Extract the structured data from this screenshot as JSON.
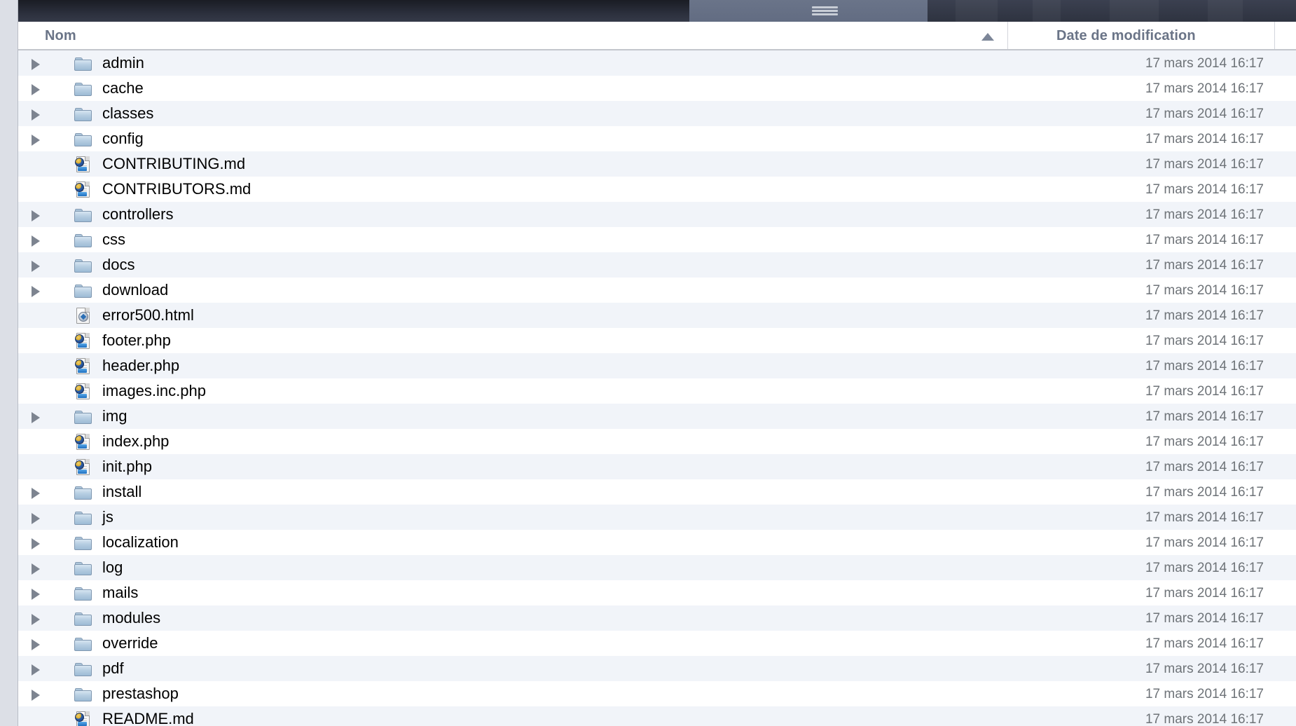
{
  "window": {
    "grip_icon": "drag-handle-icon"
  },
  "columns": {
    "name_label": "Nom",
    "date_label": "Date de modification",
    "sort_indicator": "sort-ascending-arrow",
    "sorted_by": "Nom",
    "sort_direction": "ascending"
  },
  "colors": {
    "row_stripe": "#f1f4f9",
    "row_plain": "#ffffff",
    "header_text": "#6a7487",
    "date_text": "#6e7378",
    "folder_blue": "#b7cee2",
    "chrome_dark": "#2b2f3c"
  },
  "files": [
    {
      "name": "admin",
      "type": "folder",
      "expandable": true,
      "date": "17 mars 2014 16:17"
    },
    {
      "name": "cache",
      "type": "folder",
      "expandable": true,
      "date": "17 mars 2014 16:17"
    },
    {
      "name": "classes",
      "type": "folder",
      "expandable": true,
      "date": "17 mars 2014 16:17"
    },
    {
      "name": "config",
      "type": "folder",
      "expandable": true,
      "date": "17 mars 2014 16:17"
    },
    {
      "name": "CONTRIBUTING.md",
      "type": "php-doc",
      "expandable": false,
      "date": "17 mars 2014 16:17"
    },
    {
      "name": "CONTRIBUTORS.md",
      "type": "php-doc",
      "expandable": false,
      "date": "17 mars 2014 16:17"
    },
    {
      "name": "controllers",
      "type": "folder",
      "expandable": true,
      "date": "17 mars 2014 16:17"
    },
    {
      "name": "css",
      "type": "folder",
      "expandable": true,
      "date": "17 mars 2014 16:17"
    },
    {
      "name": "docs",
      "type": "folder",
      "expandable": true,
      "date": "17 mars 2014 16:17"
    },
    {
      "name": "download",
      "type": "folder",
      "expandable": true,
      "date": "17 mars 2014 16:17"
    },
    {
      "name": "error500.html",
      "type": "html-doc",
      "expandable": false,
      "date": "17 mars 2014 16:17"
    },
    {
      "name": "footer.php",
      "type": "php-doc",
      "expandable": false,
      "date": "17 mars 2014 16:17"
    },
    {
      "name": "header.php",
      "type": "php-doc",
      "expandable": false,
      "date": "17 mars 2014 16:17"
    },
    {
      "name": "images.inc.php",
      "type": "php-doc",
      "expandable": false,
      "date": "17 mars 2014 16:17"
    },
    {
      "name": "img",
      "type": "folder",
      "expandable": true,
      "date": "17 mars 2014 16:17"
    },
    {
      "name": "index.php",
      "type": "php-doc",
      "expandable": false,
      "date": "17 mars 2014 16:17"
    },
    {
      "name": "init.php",
      "type": "php-doc",
      "expandable": false,
      "date": "17 mars 2014 16:17"
    },
    {
      "name": "install",
      "type": "folder",
      "expandable": true,
      "date": "17 mars 2014 16:17"
    },
    {
      "name": "js",
      "type": "folder",
      "expandable": true,
      "date": "17 mars 2014 16:17"
    },
    {
      "name": "localization",
      "type": "folder",
      "expandable": true,
      "date": "17 mars 2014 16:17"
    },
    {
      "name": "log",
      "type": "folder",
      "expandable": true,
      "date": "17 mars 2014 16:17"
    },
    {
      "name": "mails",
      "type": "folder",
      "expandable": true,
      "date": "17 mars 2014 16:17"
    },
    {
      "name": "modules",
      "type": "folder",
      "expandable": true,
      "date": "17 mars 2014 16:17"
    },
    {
      "name": "override",
      "type": "folder",
      "expandable": true,
      "date": "17 mars 2014 16:17"
    },
    {
      "name": "pdf",
      "type": "folder",
      "expandable": true,
      "date": "17 mars 2014 16:17"
    },
    {
      "name": "prestashop",
      "type": "folder",
      "expandable": true,
      "date": "17 mars 2014 16:17"
    },
    {
      "name": "README.md",
      "type": "php-doc",
      "expandable": false,
      "date": "17 mars 2014 16:17"
    }
  ]
}
